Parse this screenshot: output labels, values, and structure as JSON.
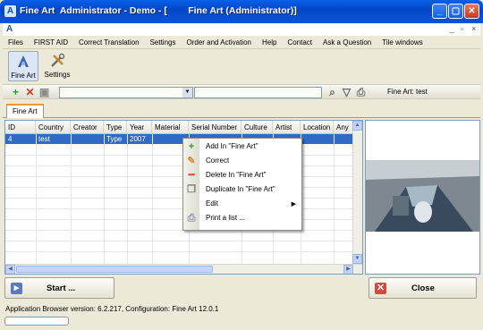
{
  "window": {
    "title": "Fine Art  Administrator - Demo - [        Fine Art (Administrator)]",
    "app_icon": "fine-art-icon",
    "controls": {
      "minimize": "_",
      "maximize": "▢",
      "close": "✕"
    },
    "mdi_controls": {
      "minimize": "_",
      "restore": "▫",
      "close": "×"
    }
  },
  "menu": [
    "Files",
    "FIRST AID",
    "Correct Translation",
    "Settings",
    "Order and Activation",
    "Help",
    "Contact",
    "Ask a Question",
    "Tile windows"
  ],
  "ribbon": [
    {
      "label": "Fine Art",
      "icon": "fine-art-icon"
    },
    {
      "label": "Settings",
      "icon": "tools-icon"
    }
  ],
  "toolbar": {
    "combo_value": "",
    "field_value": "",
    "status": "Fine Art: test"
  },
  "tabs": [
    "Fine Art"
  ],
  "grid": {
    "columns": [
      "ID",
      "Country",
      "Creator",
      "Type",
      "Year",
      "Material",
      "Serial Number",
      "Culture",
      "Artist",
      "Location",
      "Any"
    ],
    "rows": [
      [
        "4",
        "test",
        "",
        "Type",
        "2007",
        "",
        "",
        "",
        "",
        "",
        ""
      ]
    ]
  },
  "context_menu": [
    {
      "label": "Add  In \"Fine Art\"",
      "icon": "plus-icon"
    },
    {
      "label": "Correct",
      "icon": "pencil-icon"
    },
    {
      "label": "Delete  In \"Fine Art\"",
      "icon": "minus-icon"
    },
    {
      "label": "Duplicate  In \"Fine Art\"",
      "icon": "copy-icon"
    },
    {
      "label": "Edit",
      "icon": "",
      "submenu": "▶"
    },
    {
      "label": "Print a list ...",
      "icon": "printer-icon"
    }
  ],
  "buttons": {
    "start": "Start ...",
    "close": "Close"
  },
  "status": {
    "text": "Application Browser version: 6.2.217, Configuration: Fine Art 12.0.1"
  },
  "colors": {
    "title_bar": "#0a53d8",
    "selection": "#316ac5",
    "window_bg": "#ece9d8"
  }
}
